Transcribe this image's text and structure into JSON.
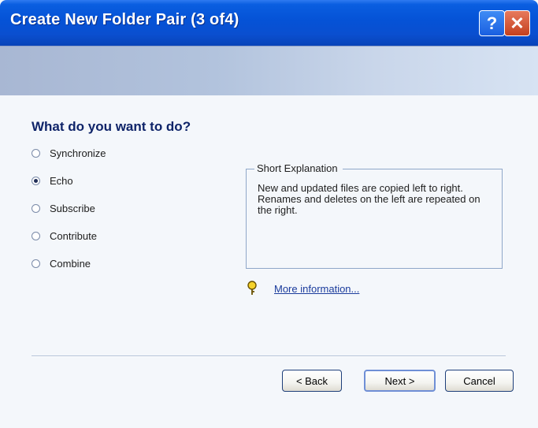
{
  "window": {
    "title": "Create New Folder Pair (3 of4)",
    "help_symbol": "?",
    "close_symbol": "✕"
  },
  "main": {
    "heading": "What do you want to do?",
    "options": [
      {
        "label": "Synchronize",
        "checked": false
      },
      {
        "label": "Echo",
        "checked": true
      },
      {
        "label": "Subscribe",
        "checked": false
      },
      {
        "label": "Contribute",
        "checked": false
      },
      {
        "label": "Combine",
        "checked": false
      }
    ],
    "explanation": {
      "legend": "Short Explanation",
      "text": "New and updated files are copied left to right. Renames and deletes on the left are repeated on the right."
    },
    "more_info": "More information..."
  },
  "buttons": {
    "back": "< Back",
    "next": "Next >",
    "cancel": "Cancel"
  },
  "colors": {
    "title_bar": "#0552d6",
    "heading": "#0f2469",
    "link": "#1a3b9c"
  }
}
